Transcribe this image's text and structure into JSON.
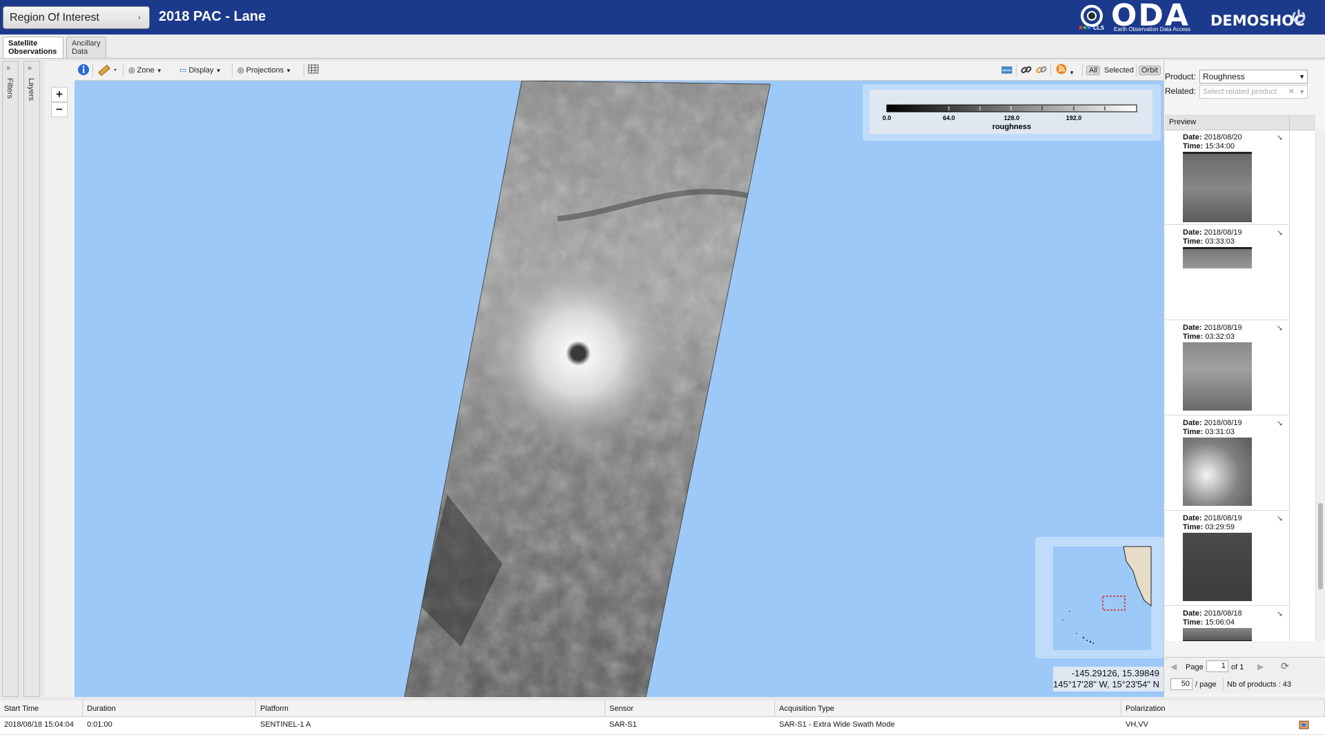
{
  "header": {
    "roi_label": "Region Of Interest",
    "title": "2018 PAC - Lane",
    "logo_text": "ODA",
    "logo_subtitle": "Earth Observation Data Access",
    "logo_cls": "CLS",
    "org": "DEMOSHOC",
    "logout_icon": "power-icon",
    "colors": {
      "header_bg": "#1b3a8c",
      "ocean": "#9dc9f8"
    }
  },
  "tabs": [
    {
      "line1": "Satellite",
      "line2": "Observations"
    },
    {
      "line1": "Ancillary",
      "line2": "Data"
    }
  ],
  "side_panels": {
    "filters": "Filters",
    "layers": "Layers"
  },
  "zoom": {
    "in": "+",
    "out": "−"
  },
  "toolbar": {
    "zone": "Zone",
    "display": "Display",
    "projections": "Projections",
    "filter_all": "All",
    "filter_selected": "Selected",
    "orbit": "Orbit"
  },
  "legend": {
    "ticks": [
      "0.0",
      "64.0",
      "128.0",
      "192.0"
    ],
    "title": "roughness"
  },
  "coords": {
    "decimal": "-145.29126, 15.39849",
    "dms": "145°17'28\" W, 15°23'54\" N"
  },
  "right_panel": {
    "product_label": "Product:",
    "product_value": "Roughness",
    "related_label": "Related:",
    "related_placeholder": "Select related product",
    "preview_header": "Preview",
    "date_label": "Date:",
    "time_label": "Time:",
    "previews": [
      {
        "date": "2018/08/20",
        "time": "15:34:00"
      },
      {
        "date": "2018/08/19",
        "time": "03:33:03"
      },
      {
        "date": "2018/08/19",
        "time": "03:32:03"
      },
      {
        "date": "2018/08/19",
        "time": "03:31:03"
      },
      {
        "date": "2018/08/19",
        "time": "03:29:59"
      },
      {
        "date": "2018/08/18",
        "time": "15:06:04"
      }
    ],
    "pager": {
      "page_label": "Page",
      "page_value": "1",
      "of_label": "of 1",
      "per_page_value": "50",
      "per_page_label": "/ page",
      "count_label": "Nb of products : 43"
    }
  },
  "table": {
    "headers": [
      "Start Time",
      "Duration",
      "Platform",
      "Sensor",
      "Acquisition Type",
      "Polarization"
    ],
    "rows": [
      [
        "2018/08/18 15:04:04",
        "0:01:00",
        "SENTINEL-1 A",
        "SAR-S1",
        "SAR-S1 - Extra Wide Swath Mode",
        "VH,VV"
      ]
    ]
  }
}
